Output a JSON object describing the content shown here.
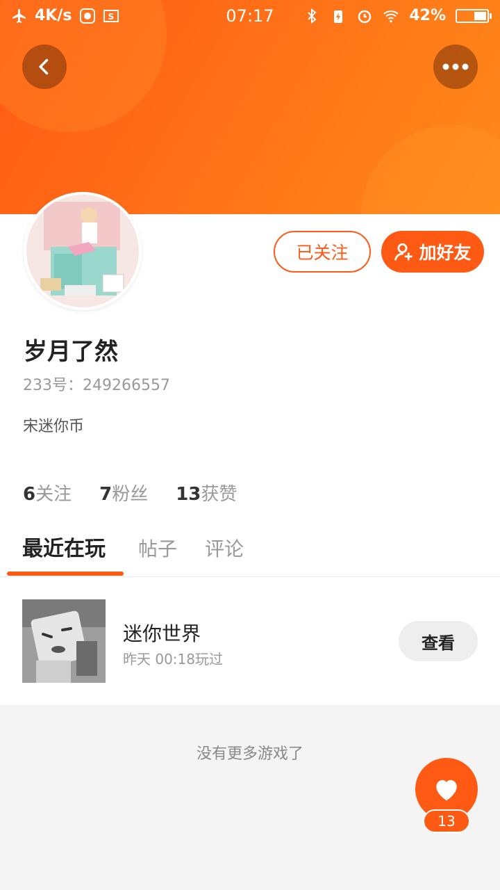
{
  "status_bar": {
    "speed": "4K/s",
    "time": "07:17",
    "battery": "42%",
    "battery_level": 0.42
  },
  "profile": {
    "name": "岁月了然",
    "id_label": "233号：249266557",
    "bio": "宋迷你币",
    "followed_label": "已关注",
    "add_friend_label": "加好友"
  },
  "stats": [
    {
      "num": "6",
      "label": "关注"
    },
    {
      "num": "7",
      "label": "粉丝"
    },
    {
      "num": "13",
      "label": "获赞"
    }
  ],
  "tabs": [
    {
      "label": "最近在玩",
      "active": true
    },
    {
      "label": "帖子",
      "active": false
    },
    {
      "label": "评论",
      "active": false
    }
  ],
  "games": [
    {
      "title": "迷你世界",
      "played": "昨天 00:18玩过",
      "action": "查看"
    }
  ],
  "footer": {
    "no_more": "没有更多游戏了",
    "like_count": "13"
  },
  "colors": {
    "accent": "#ff5a14",
    "header_start": "#ff5a14",
    "header_end": "#ff8a1a"
  }
}
